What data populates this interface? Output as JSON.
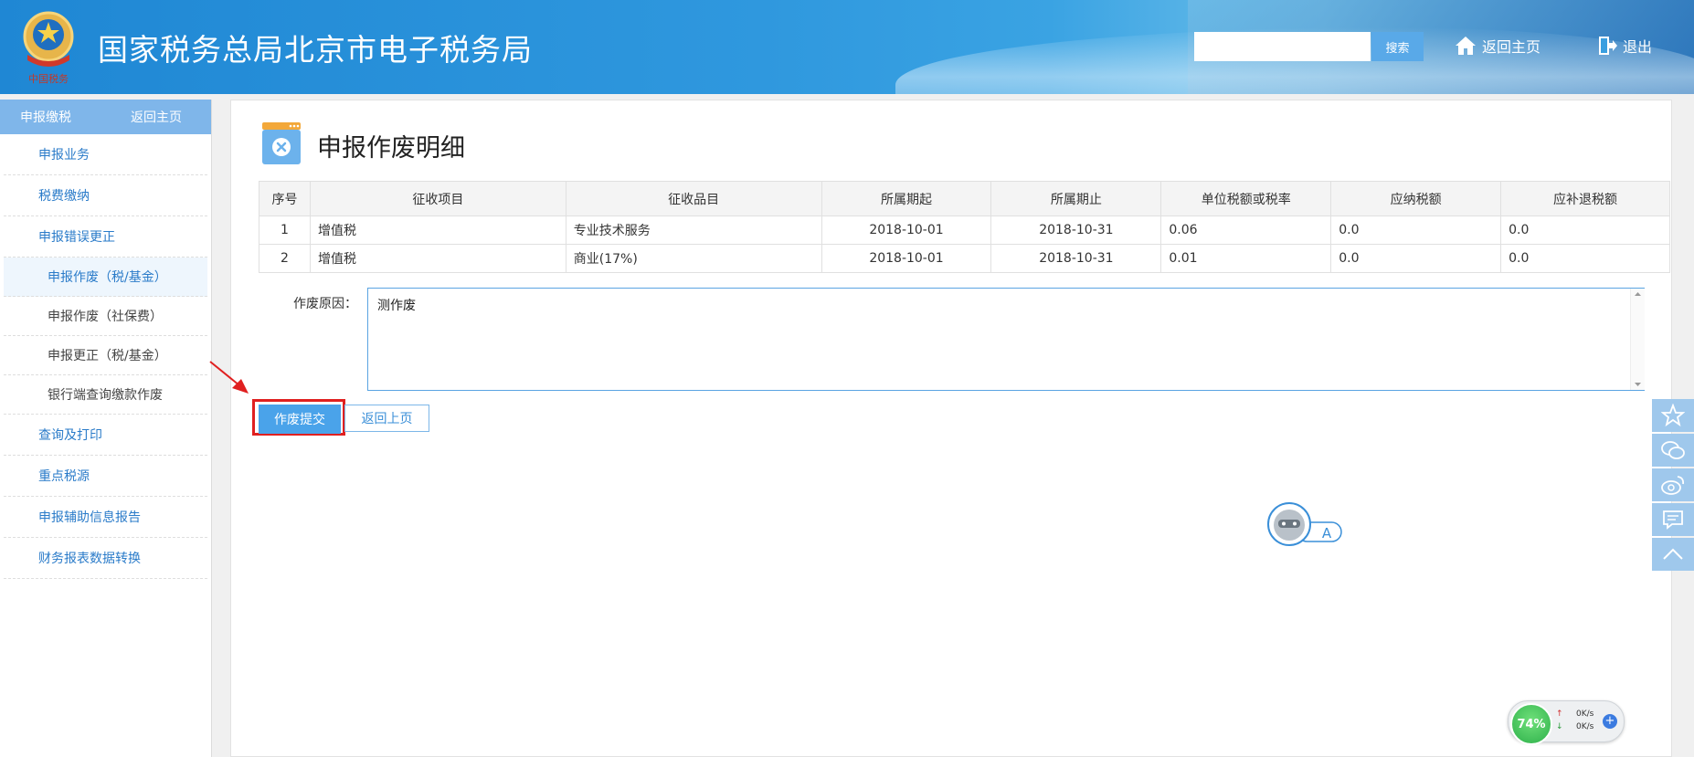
{
  "header": {
    "site_title": "国家税务总局北京市电子税务局",
    "search_placeholder": "",
    "search_button": "搜索",
    "home_link": "返回主页",
    "logout_link": "退出"
  },
  "sidebar": {
    "head_title": "申报缴税",
    "head_link": "返回主页",
    "items": [
      {
        "label": "申报业务",
        "level": "top"
      },
      {
        "label": "税费缴纳",
        "level": "top"
      },
      {
        "label": "申报错误更正",
        "level": "top"
      },
      {
        "label": "申报作废（税/基金）",
        "level": "sub",
        "active": true
      },
      {
        "label": "申报作废（社保费）",
        "level": "sub"
      },
      {
        "label": "申报更正（税/基金）",
        "level": "sub"
      },
      {
        "label": "银行端查询缴款作废",
        "level": "sub"
      },
      {
        "label": "查询及打印",
        "level": "top"
      },
      {
        "label": "重点税源",
        "level": "top"
      },
      {
        "label": "申报辅助信息报告",
        "level": "top"
      },
      {
        "label": "财务报表数据转换",
        "level": "top"
      }
    ]
  },
  "main": {
    "page_title": "申报作废明细",
    "table": {
      "headers": [
        "序号",
        "征收项目",
        "征收品目",
        "所属期起",
        "所属期止",
        "单位税额或税率",
        "应纳税额",
        "应补退税额"
      ],
      "rows": [
        [
          "1",
          "增值税",
          "专业技术服务",
          "2018-10-01",
          "2018-10-31",
          "0.06",
          "0.0",
          "0.0"
        ],
        [
          "2",
          "增值税",
          "商业(17%)",
          "2018-10-01",
          "2018-10-31",
          "0.01",
          "0.0",
          "0.0"
        ]
      ]
    },
    "reason_label": "作废原因：",
    "reason_value": "测作废",
    "submit_button": "作废提交",
    "back_button": "返回上页"
  },
  "helper": {
    "badge": "A"
  },
  "net_widget": {
    "percent": "74%",
    "up": "0K/s",
    "down": "0K/s",
    "plus": "+"
  },
  "colors": {
    "header_blue": "#2f98de",
    "sidebar_head": "#7fb6ea",
    "link_blue": "#2a7bc9",
    "submit_blue": "#4aa3ea",
    "highlight_red": "#e02020"
  }
}
